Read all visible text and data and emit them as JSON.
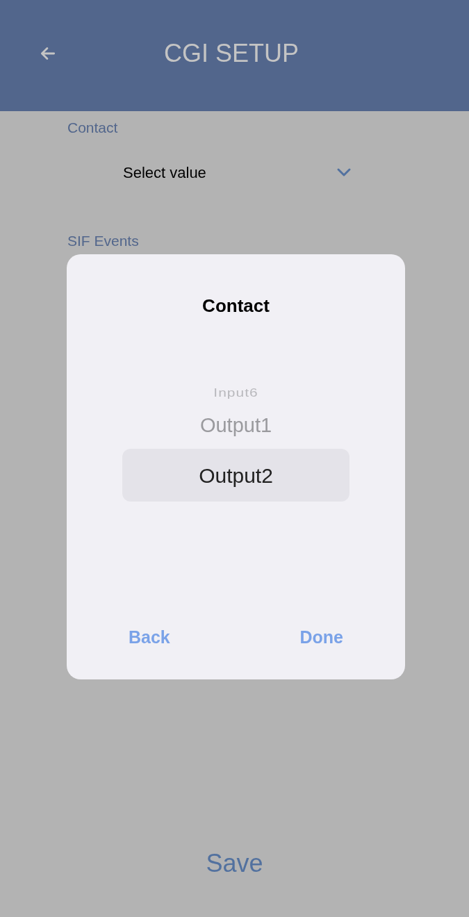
{
  "header": {
    "title": "CGI SETUP"
  },
  "form": {
    "contact_label": "Contact",
    "contact_value": "Select value",
    "sif_events_label": "SIF Events"
  },
  "picker_dialog": {
    "title": "Contact",
    "options": [
      {
        "label": "Input6",
        "selected": false
      },
      {
        "label": "Output1",
        "selected": false
      },
      {
        "label": "Output2",
        "selected": true
      }
    ],
    "buttons": [
      "Back",
      "Done"
    ]
  },
  "save_button": "Save"
}
